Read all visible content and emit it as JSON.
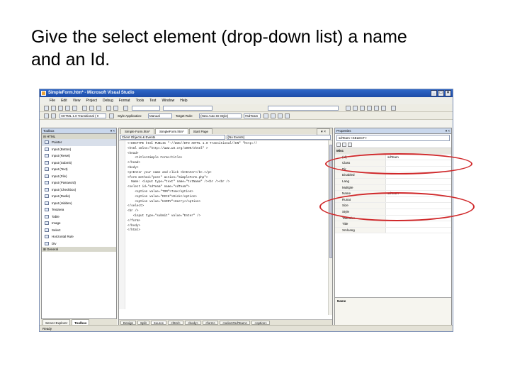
{
  "slide": {
    "title": "Give the select element (drop-down list) a name\nand an Id."
  },
  "window": {
    "title": "SimpleForm.htm* - Microsoft Visual Studio",
    "controls": [
      "_",
      "□",
      "×"
    ]
  },
  "menu": [
    "File",
    "Edit",
    "View",
    "Project",
    "Debug",
    "Format",
    "Tools",
    "Test",
    "Window",
    "Help"
  ],
  "toolbar2": {
    "doctype": "XHTML 1.0 Transitional ( ▾",
    "style_app_label": "Style Application:",
    "style_app_value": "Manual",
    "target_rule_label": "Target Rule:",
    "target_rule_value": "(New Auto ID Style)",
    "element_combo": "#sdTeam"
  },
  "toolbox": {
    "title": "Toolbox",
    "group_html": "HTML",
    "items": [
      "Pointer",
      "Input (Button)",
      "Input (Reset)",
      "Input (Submit)",
      "Input (Text)",
      "Input (File)",
      "Input (Password)",
      "Input (Checkbox)",
      "Input (Radio)",
      "Input (Hidden)",
      "Textarea",
      "Table",
      "Image",
      "Select",
      "Horizontal Rule",
      "Div"
    ],
    "group_general": "General",
    "bottom_tabs": [
      "Server Explorer",
      "Toolbox"
    ]
  },
  "editor": {
    "tabs": [
      "Simple Form.htm*",
      "SimpleForm.htm*",
      "Start Page"
    ],
    "nav_left": "Client Objects & Events",
    "nav_right": "(No Events)",
    "code_lines": [
      "<!DOCTYPE html PUBLIC \"-//W3C//DTD XHTML 1.0 Transitional//EN\" \"http://",
      "<html xmlns=\"http://www.w3.org/1999/xhtml\" >",
      "<head>",
      "    <title>Simple Form</title>",
      "</head>",
      "<body>",
      "<p>Enter your name and click <b>Enter</b>.</p>",
      "<form method=\"post\" action=\"SimpleForm.php\">",
      "  Name: <input type=\"text\" name=\"txtName\" /><br /><br />",
      "<select id=\"sdTeam\" name=\"sdTeam\">",
      "    <option value=\"TOM\">Tom</option>",
      "    <option value=\"DICK\">Dick</option>",
      "    <option value=\"HARRY\">Harry</option>",
      "</select>",
      "<br />",
      "",
      "   <input type=\"submit\" value=\"Enter\" />",
      "</form>",
      "</body>",
      "</html>"
    ],
    "bottom_tabs": [
      "Design",
      "Split",
      "Source"
    ],
    "breadcrumbs": [
      "<html>",
      "<body>",
      "<form>",
      "<select#sdTeam>",
      "<option>"
    ]
  },
  "properties": {
    "title": "Properties",
    "object": "sdTeam <SELECT>",
    "rows": [
      {
        "key": "Misc",
        "value": "",
        "group": true
      },
      {
        "key": "(Id)",
        "value": "sdTeam"
      },
      {
        "key": "Class",
        "value": ""
      },
      {
        "key": "Dir",
        "value": ""
      },
      {
        "key": "Disabled",
        "value": ""
      },
      {
        "key": "Lang",
        "value": ""
      },
      {
        "key": "Multiple",
        "value": ""
      },
      {
        "key": "Name",
        "value": "sdTeam"
      },
      {
        "key": "Runat",
        "value": ""
      },
      {
        "key": "Size",
        "value": ""
      },
      {
        "key": "Style",
        "value": ""
      },
      {
        "key": "TabIndex",
        "value": ""
      },
      {
        "key": "Title",
        "value": ""
      },
      {
        "key": "XmlLang",
        "value": ""
      }
    ],
    "description": "Name"
  },
  "status": "Ready",
  "colors": {
    "callout": "#d0282a",
    "titlebar": "#2f68c9"
  }
}
